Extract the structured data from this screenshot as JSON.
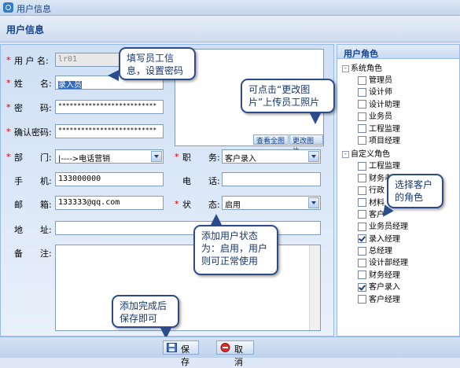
{
  "window": {
    "title": "用户信息"
  },
  "header": {
    "title": "用户信息"
  },
  "form": {
    "username": {
      "label": "用 户 名:",
      "value": "lr01"
    },
    "name": {
      "label": "姓　　名:",
      "value": "录入员"
    },
    "password": {
      "label": "密　　码:",
      "value": "**************************"
    },
    "confirm_password": {
      "label": "确认密码:",
      "value": "**************************"
    },
    "department": {
      "label": "部　　门:",
      "value": "|---->电话营销"
    },
    "position": {
      "label": "职　　务:",
      "value": "客户录入"
    },
    "mobile": {
      "label": "手　　机:",
      "value": "133000000"
    },
    "phone": {
      "label": "电　　话:",
      "value": ""
    },
    "email": {
      "label": "邮　　箱:",
      "value": "133333@qq.com"
    },
    "status": {
      "label": "状　　态:",
      "value": "启用"
    },
    "address": {
      "label": "地　　址:",
      "value": ""
    },
    "remark": {
      "label": "备　　注:",
      "value": ""
    },
    "required_mark": "*"
  },
  "photo": {
    "view_full": "查看全图",
    "change": "更改图片"
  },
  "callouts": {
    "fill_info": "填写员工信息，设置密码",
    "change_photo": "可点击“更改图片”上传员工照片",
    "status_hint": "添加用户状态为：启用，用户则可正常使用",
    "save_hint": "添加完成后保存即可",
    "role_hint": "选择客户的角色"
  },
  "roles": {
    "title": "用户角色",
    "system_group": "系统角色",
    "system_items": [
      {
        "label": "管理员",
        "checked": false
      },
      {
        "label": "设计师",
        "checked": false
      },
      {
        "label": "设计助理",
        "checked": false
      },
      {
        "label": "业务员",
        "checked": false
      },
      {
        "label": "工程监理",
        "checked": false
      },
      {
        "label": "项目经理",
        "checked": false
      }
    ],
    "custom_group": "自定义角色",
    "custom_items": [
      {
        "label": "工程监理",
        "checked": false
      },
      {
        "label": "财务老员",
        "checked": false
      },
      {
        "label": "行政",
        "checked": false
      },
      {
        "label": "材料",
        "checked": false
      },
      {
        "label": "客户",
        "checked": false
      },
      {
        "label": "业务员经理",
        "checked": false
      },
      {
        "label": "录入经理",
        "checked": true
      },
      {
        "label": "总经理",
        "checked": false
      },
      {
        "label": "设计部经理",
        "checked": false
      },
      {
        "label": "财务经理",
        "checked": false
      },
      {
        "label": "客户录入",
        "checked": true
      },
      {
        "label": "客户经理",
        "checked": false
      }
    ]
  },
  "footer": {
    "save": "保存",
    "cancel": "取消"
  },
  "colors": {
    "accent": "#15428b",
    "required": "#cc0000",
    "callout_border": "#2b4b8c"
  }
}
